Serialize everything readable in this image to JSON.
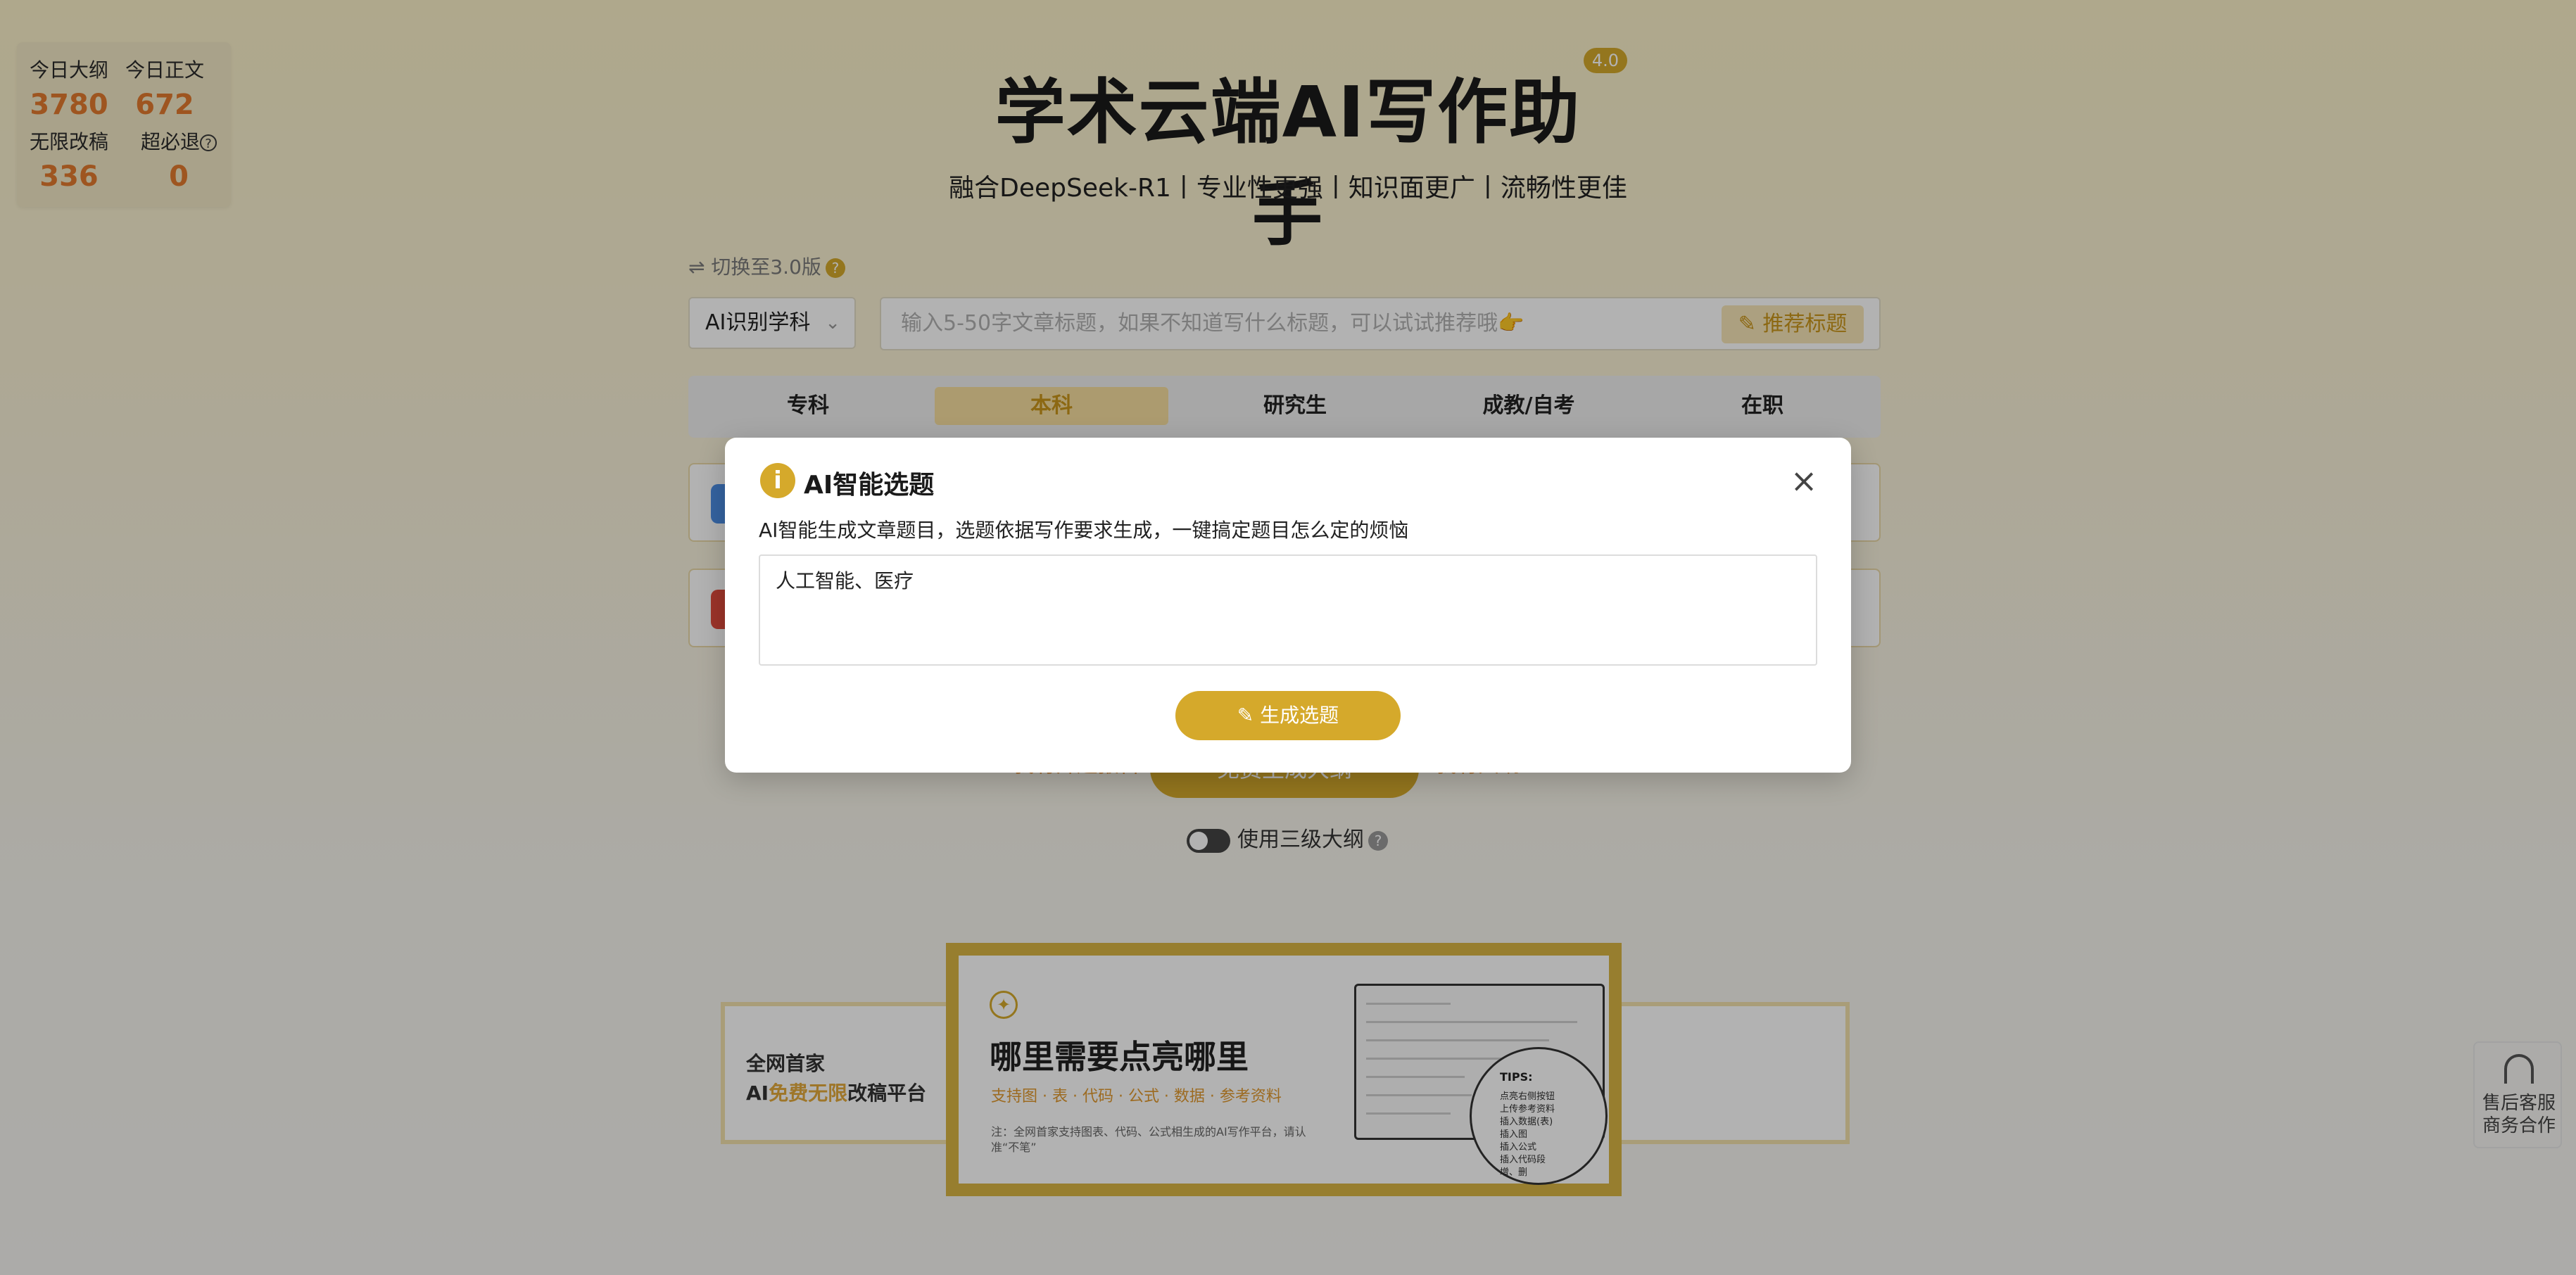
{
  "stats": {
    "today_outline_label": "今日大纲",
    "today_outline_value": "3780",
    "today_body_label": "今日正文",
    "today_body_value": "672",
    "unlimited_label": "无限改稿",
    "unlimited_value": "336",
    "refund_label": "超必退",
    "refund_value": "0"
  },
  "header": {
    "title": "学术云端AI写作助手",
    "version": "4.0",
    "subtitle": "融合DeepSeek-R1丨专业性更强丨知识面更广丨流畅性更佳"
  },
  "switch_link": "⇌ 切换至3.0版",
  "subject_select": {
    "value": "AI识别学科"
  },
  "topic_input": {
    "placeholder": "输入5-50字文章标题，如果不知道写什么标题，可以试试推荐哦👉",
    "recommend_label": "推荐标题"
  },
  "levels": [
    "专科",
    "本科",
    "研究生",
    "成教/自考",
    "在职"
  ],
  "active_level": "本科",
  "actions": {
    "left_link": "我有开题报告",
    "generate_outline": "免费生成大纲",
    "right_link": "我有大纲"
  },
  "toggle": {
    "label": "使用三级大纲"
  },
  "banner": {
    "left_line1": "全网首家",
    "left_line2_pre": "AI",
    "left_line2_hl": "免费无限",
    "left_line2_post": "改稿平台",
    "main_title": "哪里需要点亮哪里",
    "main_sub": "支持图 · 表 · 代码 · 公式 · 数据 · 参考资料",
    "main_note": "注：全网首家支持图表、代码、公式相生成的AI写作平台，请认准“不笔”",
    "tips_title": "TIPS:",
    "tips": [
      "点亮右侧按钮",
      "上传参考资料",
      "插入数据(表)",
      "插入图",
      "插入公式",
      "插入代码段",
      "增、删"
    ]
  },
  "service": {
    "line1": "售后客服",
    "line2": "商务合作"
  },
  "dialog": {
    "title": "AI智能选题",
    "description": "AI智能生成文章题目，选题依据写作要求生成，一键搞定题目怎么定的烦恼",
    "textarea_value": "人工智能、医疗",
    "generate_label": "生成选题"
  },
  "colors": {
    "accent": "#d5a92b",
    "number": "#e27a2e"
  }
}
